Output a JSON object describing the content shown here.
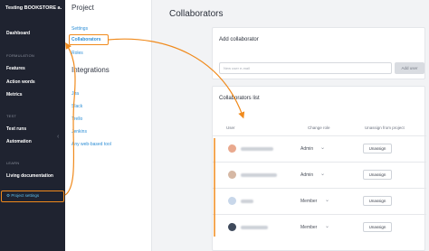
{
  "sidebar": {
    "title": "Testing BOOKSTORE a...",
    "items": [
      {
        "label": "Dashboard"
      },
      {
        "label": "Features"
      },
      {
        "label": "Action words"
      },
      {
        "label": "Metrics"
      },
      {
        "label": "Test runs"
      },
      {
        "label": "Automation"
      },
      {
        "label": "Living documentation"
      }
    ],
    "sections": {
      "formulation": "FORMULATION",
      "test": "TEST",
      "learn": "LEARN"
    },
    "collapse_glyph": "‹",
    "footer": {
      "icon": "⚙",
      "label": "Project settings"
    }
  },
  "subpanel": {
    "project_heading": "Project",
    "project_links": [
      "Settings",
      "Collaborators",
      "Roles"
    ],
    "integrations_heading": "Integrations",
    "integration_links": [
      "Jira",
      "Slack",
      "Trello",
      "Jenkins",
      "Any web-based tool"
    ]
  },
  "main": {
    "title": "Collaborators",
    "add_card": {
      "title": "Add collaborator",
      "input_placeholder": "New user e-mail",
      "add_button": "Add user"
    },
    "list_card": {
      "title": "Collaborators list",
      "columns": {
        "user": "User",
        "role": "Change role",
        "unassign": "Unassign from project"
      },
      "rows": [
        {
          "role": "Admin",
          "button": "Unassign",
          "avatar_color": "#e9a98e"
        },
        {
          "role": "Admin",
          "button": "Unassign",
          "avatar_color": "#d6b8a4"
        },
        {
          "role": "Member",
          "button": "Unassign",
          "avatar_color": "#c8d7ea"
        },
        {
          "role": "Member",
          "button": "Unassign",
          "avatar_color": "#3f4a5c"
        }
      ]
    }
  },
  "colors": {
    "sidebar_bg": "#1f2330",
    "accent_orange": "#f08a1c",
    "link_blue": "#2e8fd6",
    "active_blue": "#5ec0ee"
  }
}
